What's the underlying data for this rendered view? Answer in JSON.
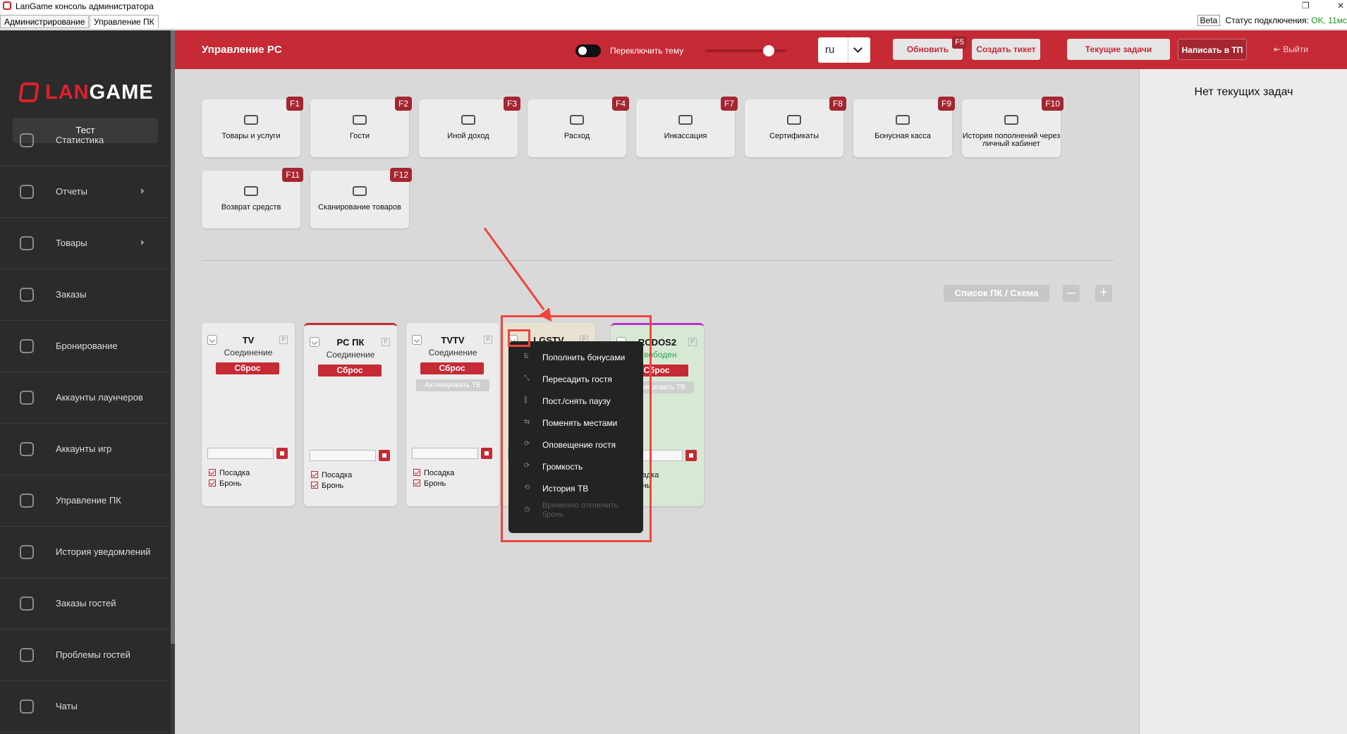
{
  "window": {
    "title": "LanGame консоль администратора",
    "tabs": [
      "Администрирование",
      "Управление ПК"
    ],
    "beta": "Beta",
    "connection_label": "Статус подключения:",
    "connection_value": "OK, 11мс"
  },
  "sidebar": {
    "logo_prefix": "LAN",
    "logo_suffix": "GAME",
    "user": "Тест",
    "items": [
      {
        "label": "Статистика",
        "icon": "pie-chart-icon",
        "submenu": false
      },
      {
        "label": "Отчеты",
        "icon": "report-icon",
        "submenu": true
      },
      {
        "label": "Товары",
        "icon": "cloche-icon",
        "submenu": true
      },
      {
        "label": "Заказы",
        "icon": "grid-icon",
        "submenu": false
      },
      {
        "label": "Бронирование",
        "icon": "edit-icon",
        "submenu": false
      },
      {
        "label": "Аккаунты лаунчеров",
        "icon": "account-icon",
        "submenu": false
      },
      {
        "label": "Аккаунты игр",
        "icon": "account-icon",
        "submenu": false
      },
      {
        "label": "Управление ПК",
        "icon": "monitor-icon",
        "submenu": false
      },
      {
        "label": "История уведомлений",
        "icon": "bell-icon",
        "submenu": false
      },
      {
        "label": "Заказы гостей",
        "icon": "cloche-icon",
        "submenu": false
      },
      {
        "label": "Проблемы гостей",
        "icon": "warning-icon",
        "submenu": false
      },
      {
        "label": "Чаты",
        "icon": "chat-icon",
        "submenu": false
      }
    ]
  },
  "header": {
    "title": "Управление PC",
    "theme_toggle": "Переключить тему",
    "language": "ru",
    "refresh": "Обновить",
    "refresh_key": "F5",
    "create_ticket": "Создать тикет",
    "current_tasks": "Текущие задачи",
    "write_support": "Написать в ТП",
    "logout": "Выйти"
  },
  "right_panel": {
    "title": "Нет текущих задач"
  },
  "tiles": [
    {
      "label": "Товары и услуги",
      "key": "F1",
      "icon": "bowl-icon"
    },
    {
      "label": "Гости",
      "key": "F2",
      "icon": "users-icon"
    },
    {
      "label": "Иной доход",
      "key": "F3",
      "icon": "trend-up-icon"
    },
    {
      "label": "Расход",
      "key": "F4",
      "icon": "trend-down-icon"
    },
    {
      "label": "Инкассация",
      "key": "F7",
      "icon": "cash-icon"
    },
    {
      "label": "Сертификаты",
      "key": "F8",
      "icon": "cash-icon"
    },
    {
      "label": "Бонусная касса",
      "key": "F9",
      "icon": "cash-icon"
    },
    {
      "label": "История пополнений через личный кабинет",
      "key": "F10",
      "icon": "cash-icon"
    },
    {
      "label": "Возврат средств",
      "key": "F11",
      "icon": "cash-icon"
    },
    {
      "label": "Сканирование товаров",
      "key": "F12",
      "icon": "cash-icon"
    }
  ],
  "view_switch": "Список ПК / Схема",
  "zoom_minus": "–",
  "zoom_plus": "+",
  "pcs": [
    {
      "name": "TV",
      "status": "Соединение",
      "reset": "Сброс"
    },
    {
      "name": "PC ПК",
      "status": "Соединение",
      "reset": "Сброс"
    },
    {
      "name": "TVTV",
      "status": "Соединение",
      "reset": "Сброс",
      "activate": "Активировать ТВ"
    },
    {
      "name": "LGSTV"
    },
    {
      "name": "RCDOS2",
      "status": "Свободен",
      "reset": "Сброс",
      "activate": "Активировать ТВ"
    }
  ],
  "checkbox_labels": {
    "seat": "Посадка",
    "booking": "Бронь"
  },
  "context_menu": [
    {
      "label": "Пополнить бонусами",
      "icon": "Б",
      "disabled": false
    },
    {
      "label": "Пересадить гостя",
      "icon": "⤡",
      "disabled": false
    },
    {
      "label": "Пост./снять паузу",
      "icon": "∥",
      "disabled": false
    },
    {
      "label": "Поменять местами",
      "icon": "⇆",
      "disabled": false
    },
    {
      "label": "Оповещение гостя",
      "icon": "⟳",
      "disabled": false
    },
    {
      "label": "Громкость",
      "icon": "⟳",
      "disabled": false
    },
    {
      "label": "История ТВ",
      "icon": "⟲",
      "disabled": false
    },
    {
      "label": "Временно отключить бронь",
      "icon": "◷",
      "disabled": true
    }
  ],
  "colors": {
    "brand": "#c52a35",
    "sidebar": "#2b2b2b",
    "annotation": "#f2433f"
  }
}
